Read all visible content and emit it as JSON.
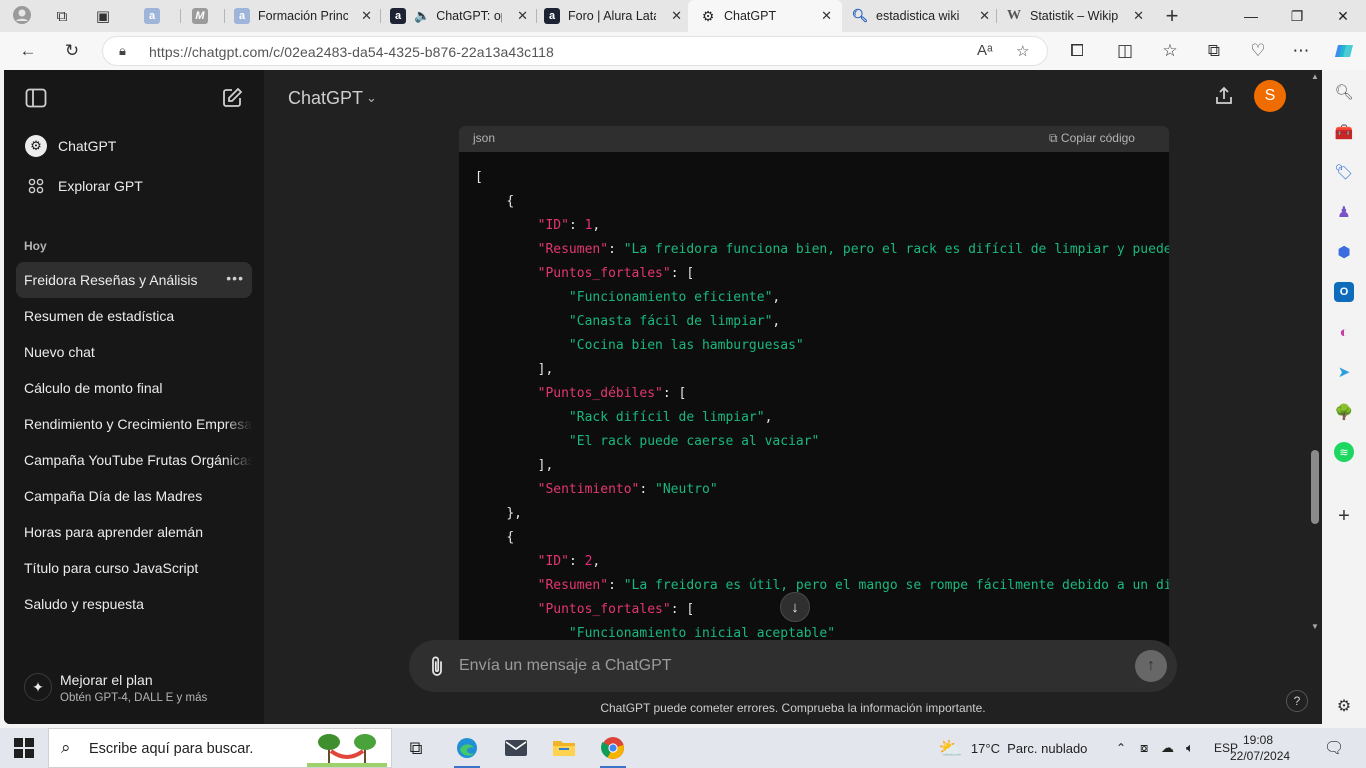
{
  "browser": {
    "tabs": [
      {
        "title": "",
        "icon": "alura-icon"
      },
      {
        "title": "",
        "icon": "m-icon"
      },
      {
        "title": "Formación Principiante",
        "icon": "alura-icon"
      },
      {
        "title": "ChatGPT: op",
        "icon": "extension-icon"
      },
      {
        "title": "Foro | Alura Latam",
        "icon": "extension-icon"
      },
      {
        "title": "ChatGPT",
        "icon": "chatgpt-icon",
        "active": true
      },
      {
        "title": "estadistica wikipedia",
        "icon": "search-icon"
      },
      {
        "title": "Statistik – Wikipedia",
        "icon": "wikipedia-icon"
      }
    ],
    "url": "https://chatgpt.com/c/02ea2483-da54-4325-b876-22a13a43c118"
  },
  "sidebar": {
    "nav": [
      {
        "label": "ChatGPT",
        "icon": "chatgpt-logo-icon"
      },
      {
        "label": "Explorar GPT",
        "icon": "grid-icon"
      }
    ],
    "section_label": "Hoy",
    "chats": [
      {
        "label": "Freidora Reseñas y Análisis",
        "selected": true
      },
      {
        "label": "Resumen de estadística"
      },
      {
        "label": "Nuevo chat"
      },
      {
        "label": "Cálculo de monto final"
      },
      {
        "label": "Rendimiento y Crecimiento Empresarial"
      },
      {
        "label": "Campaña YouTube Frutas Orgánicas"
      },
      {
        "label": "Campaña Día de las Madres"
      },
      {
        "label": "Horas para aprender alemán"
      },
      {
        "label": "Título para curso JavaScript"
      },
      {
        "label": "Saludo y respuesta"
      }
    ],
    "upgrade": {
      "title": "Mejorar el plan",
      "subtitle": "Obtén GPT-4, DALL E y más"
    }
  },
  "main": {
    "model": "ChatGPT",
    "avatar_initial": "S",
    "avatar_color": "#ef6c00",
    "code": {
      "language": "json",
      "copy_label": "Copiar código",
      "lines": [
        "[",
        "    {",
        "        \"ID\": 1,",
        "        \"Resumen\": \"La freidora funciona bien, pero el rack es difícil de limpiar y puede caerse al vaciar.\",",
        "        \"Puntos_fortales\": [",
        "            \"Funcionamiento eficiente\",",
        "            \"Canasta fácil de limpiar\",",
        "            \"Cocina bien las hamburguesas\"",
        "        ],",
        "        \"Puntos_débiles\": [",
        "            \"Rack difícil de limpiar\",",
        "            \"El rack puede caerse al vaciar\"",
        "        ],",
        "        \"Sentimiento\": \"Neutro\"",
        "    },",
        "    {",
        "        \"ID\": 2,",
        "        \"Resumen\": \"La freidora es útil, pero el mango se rompe fácilmente debido a un diseño deficiente.\",",
        "        \"Puntos_fortales\": [",
        "            \"Funcionamiento inicial aceptable\""
      ]
    },
    "composer_placeholder": "Envía un mensaje a ChatGPT",
    "disclaimer": "ChatGPT puede cometer errores. Comprueba la información importante.",
    "help_label": "?"
  },
  "taskbar": {
    "search_placeholder": "Escribe aquí para buscar.",
    "weather": "17°C  Parc. nublado",
    "language": "ESP",
    "time": "19:08",
    "date": "22/07/2024"
  },
  "colors": {
    "json_key": "#e33672",
    "json_string": "#19b87d",
    "json_number": "#df3079"
  }
}
